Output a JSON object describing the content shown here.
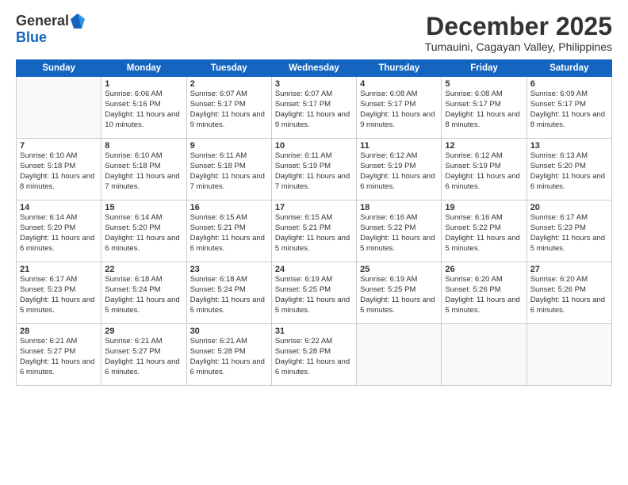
{
  "header": {
    "logo_general": "General",
    "logo_blue": "Blue",
    "month_year": "December 2025",
    "location": "Tumauini, Cagayan Valley, Philippines"
  },
  "days_of_week": [
    "Sunday",
    "Monday",
    "Tuesday",
    "Wednesday",
    "Thursday",
    "Friday",
    "Saturday"
  ],
  "weeks": [
    [
      {
        "day": "",
        "sunrise": "",
        "sunset": "",
        "daylight": ""
      },
      {
        "day": "1",
        "sunrise": "Sunrise: 6:06 AM",
        "sunset": "Sunset: 5:16 PM",
        "daylight": "Daylight: 11 hours and 10 minutes."
      },
      {
        "day": "2",
        "sunrise": "Sunrise: 6:07 AM",
        "sunset": "Sunset: 5:17 PM",
        "daylight": "Daylight: 11 hours and 9 minutes."
      },
      {
        "day": "3",
        "sunrise": "Sunrise: 6:07 AM",
        "sunset": "Sunset: 5:17 PM",
        "daylight": "Daylight: 11 hours and 9 minutes."
      },
      {
        "day": "4",
        "sunrise": "Sunrise: 6:08 AM",
        "sunset": "Sunset: 5:17 PM",
        "daylight": "Daylight: 11 hours and 9 minutes."
      },
      {
        "day": "5",
        "sunrise": "Sunrise: 6:08 AM",
        "sunset": "Sunset: 5:17 PM",
        "daylight": "Daylight: 11 hours and 8 minutes."
      },
      {
        "day": "6",
        "sunrise": "Sunrise: 6:09 AM",
        "sunset": "Sunset: 5:17 PM",
        "daylight": "Daylight: 11 hours and 8 minutes."
      }
    ],
    [
      {
        "day": "7",
        "sunrise": "Sunrise: 6:10 AM",
        "sunset": "Sunset: 5:18 PM",
        "daylight": "Daylight: 11 hours and 8 minutes."
      },
      {
        "day": "8",
        "sunrise": "Sunrise: 6:10 AM",
        "sunset": "Sunset: 5:18 PM",
        "daylight": "Daylight: 11 hours and 7 minutes."
      },
      {
        "day": "9",
        "sunrise": "Sunrise: 6:11 AM",
        "sunset": "Sunset: 5:18 PM",
        "daylight": "Daylight: 11 hours and 7 minutes."
      },
      {
        "day": "10",
        "sunrise": "Sunrise: 6:11 AM",
        "sunset": "Sunset: 5:19 PM",
        "daylight": "Daylight: 11 hours and 7 minutes."
      },
      {
        "day": "11",
        "sunrise": "Sunrise: 6:12 AM",
        "sunset": "Sunset: 5:19 PM",
        "daylight": "Daylight: 11 hours and 6 minutes."
      },
      {
        "day": "12",
        "sunrise": "Sunrise: 6:12 AM",
        "sunset": "Sunset: 5:19 PM",
        "daylight": "Daylight: 11 hours and 6 minutes."
      },
      {
        "day": "13",
        "sunrise": "Sunrise: 6:13 AM",
        "sunset": "Sunset: 5:20 PM",
        "daylight": "Daylight: 11 hours and 6 minutes."
      }
    ],
    [
      {
        "day": "14",
        "sunrise": "Sunrise: 6:14 AM",
        "sunset": "Sunset: 5:20 PM",
        "daylight": "Daylight: 11 hours and 6 minutes."
      },
      {
        "day": "15",
        "sunrise": "Sunrise: 6:14 AM",
        "sunset": "Sunset: 5:20 PM",
        "daylight": "Daylight: 11 hours and 6 minutes."
      },
      {
        "day": "16",
        "sunrise": "Sunrise: 6:15 AM",
        "sunset": "Sunset: 5:21 PM",
        "daylight": "Daylight: 11 hours and 6 minutes."
      },
      {
        "day": "17",
        "sunrise": "Sunrise: 6:15 AM",
        "sunset": "Sunset: 5:21 PM",
        "daylight": "Daylight: 11 hours and 5 minutes."
      },
      {
        "day": "18",
        "sunrise": "Sunrise: 6:16 AM",
        "sunset": "Sunset: 5:22 PM",
        "daylight": "Daylight: 11 hours and 5 minutes."
      },
      {
        "day": "19",
        "sunrise": "Sunrise: 6:16 AM",
        "sunset": "Sunset: 5:22 PM",
        "daylight": "Daylight: 11 hours and 5 minutes."
      },
      {
        "day": "20",
        "sunrise": "Sunrise: 6:17 AM",
        "sunset": "Sunset: 5:23 PM",
        "daylight": "Daylight: 11 hours and 5 minutes."
      }
    ],
    [
      {
        "day": "21",
        "sunrise": "Sunrise: 6:17 AM",
        "sunset": "Sunset: 5:23 PM",
        "daylight": "Daylight: 11 hours and 5 minutes."
      },
      {
        "day": "22",
        "sunrise": "Sunrise: 6:18 AM",
        "sunset": "Sunset: 5:24 PM",
        "daylight": "Daylight: 11 hours and 5 minutes."
      },
      {
        "day": "23",
        "sunrise": "Sunrise: 6:18 AM",
        "sunset": "Sunset: 5:24 PM",
        "daylight": "Daylight: 11 hours and 5 minutes."
      },
      {
        "day": "24",
        "sunrise": "Sunrise: 6:19 AM",
        "sunset": "Sunset: 5:25 PM",
        "daylight": "Daylight: 11 hours and 5 minutes."
      },
      {
        "day": "25",
        "sunrise": "Sunrise: 6:19 AM",
        "sunset": "Sunset: 5:25 PM",
        "daylight": "Daylight: 11 hours and 5 minutes."
      },
      {
        "day": "26",
        "sunrise": "Sunrise: 6:20 AM",
        "sunset": "Sunset: 5:26 PM",
        "daylight": "Daylight: 11 hours and 5 minutes."
      },
      {
        "day": "27",
        "sunrise": "Sunrise: 6:20 AM",
        "sunset": "Sunset: 5:26 PM",
        "daylight": "Daylight: 11 hours and 6 minutes."
      }
    ],
    [
      {
        "day": "28",
        "sunrise": "Sunrise: 6:21 AM",
        "sunset": "Sunset: 5:27 PM",
        "daylight": "Daylight: 11 hours and 6 minutes."
      },
      {
        "day": "29",
        "sunrise": "Sunrise: 6:21 AM",
        "sunset": "Sunset: 5:27 PM",
        "daylight": "Daylight: 11 hours and 6 minutes."
      },
      {
        "day": "30",
        "sunrise": "Sunrise: 6:21 AM",
        "sunset": "Sunset: 5:28 PM",
        "daylight": "Daylight: 11 hours and 6 minutes."
      },
      {
        "day": "31",
        "sunrise": "Sunrise: 6:22 AM",
        "sunset": "Sunset: 5:28 PM",
        "daylight": "Daylight: 11 hours and 6 minutes."
      },
      {
        "day": "",
        "sunrise": "",
        "sunset": "",
        "daylight": ""
      },
      {
        "day": "",
        "sunrise": "",
        "sunset": "",
        "daylight": ""
      },
      {
        "day": "",
        "sunrise": "",
        "sunset": "",
        "daylight": ""
      }
    ]
  ]
}
